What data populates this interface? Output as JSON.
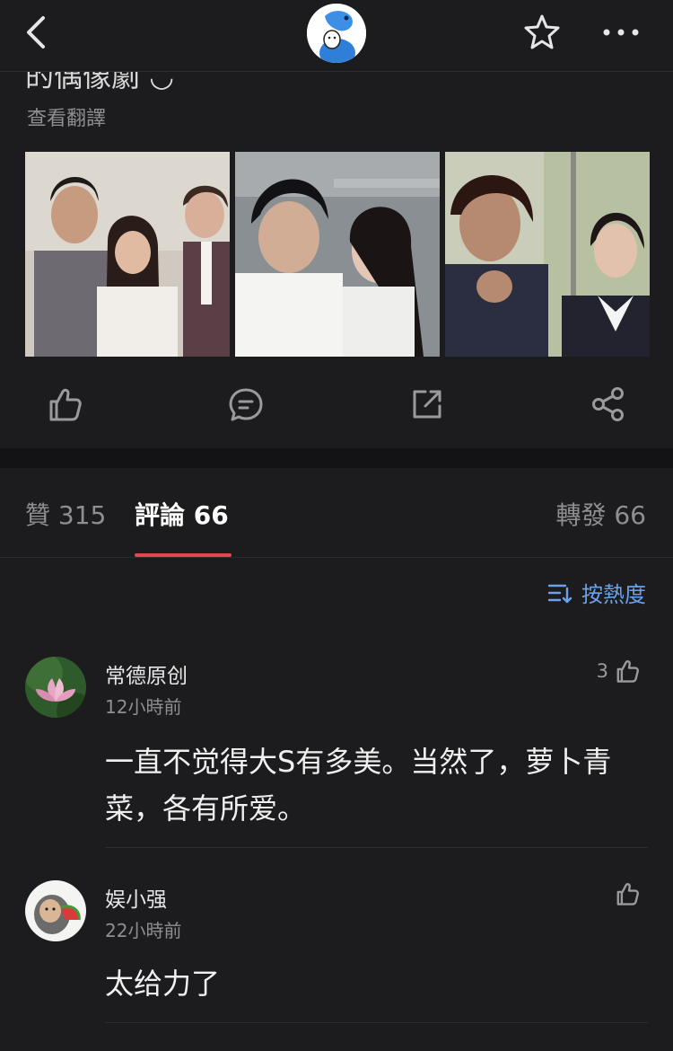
{
  "post": {
    "title_cut": "的偶像劇 ◡",
    "translate_label": "查看翻譯"
  },
  "tabs": {
    "likes": "贊 315",
    "comments": "評論 66",
    "shares": "轉發 66"
  },
  "sort": {
    "label": "按熱度"
  },
  "comments": [
    {
      "name": "常德原创",
      "time": "12小時前",
      "text": "一直不觉得大S有多美。当然了，萝卜青菜，各有所爱。",
      "likes": "3"
    },
    {
      "name": "娱小强",
      "time": "22小時前",
      "text": "太给力了",
      "likes": ""
    }
  ],
  "icons": {
    "back": "chevron-left-icon",
    "favorite": "star-icon",
    "more": "more-dots-icon",
    "like": "thumbs-up-icon",
    "comment": "comment-bubble-icon",
    "repost": "repost-icon",
    "share": "share-icon",
    "sort": "sort-icon"
  },
  "colors": {
    "background": "#1c1c1e",
    "accent_red": "#e2474f",
    "link_blue": "#6aa2ea",
    "muted_text": "#8e8e93"
  }
}
